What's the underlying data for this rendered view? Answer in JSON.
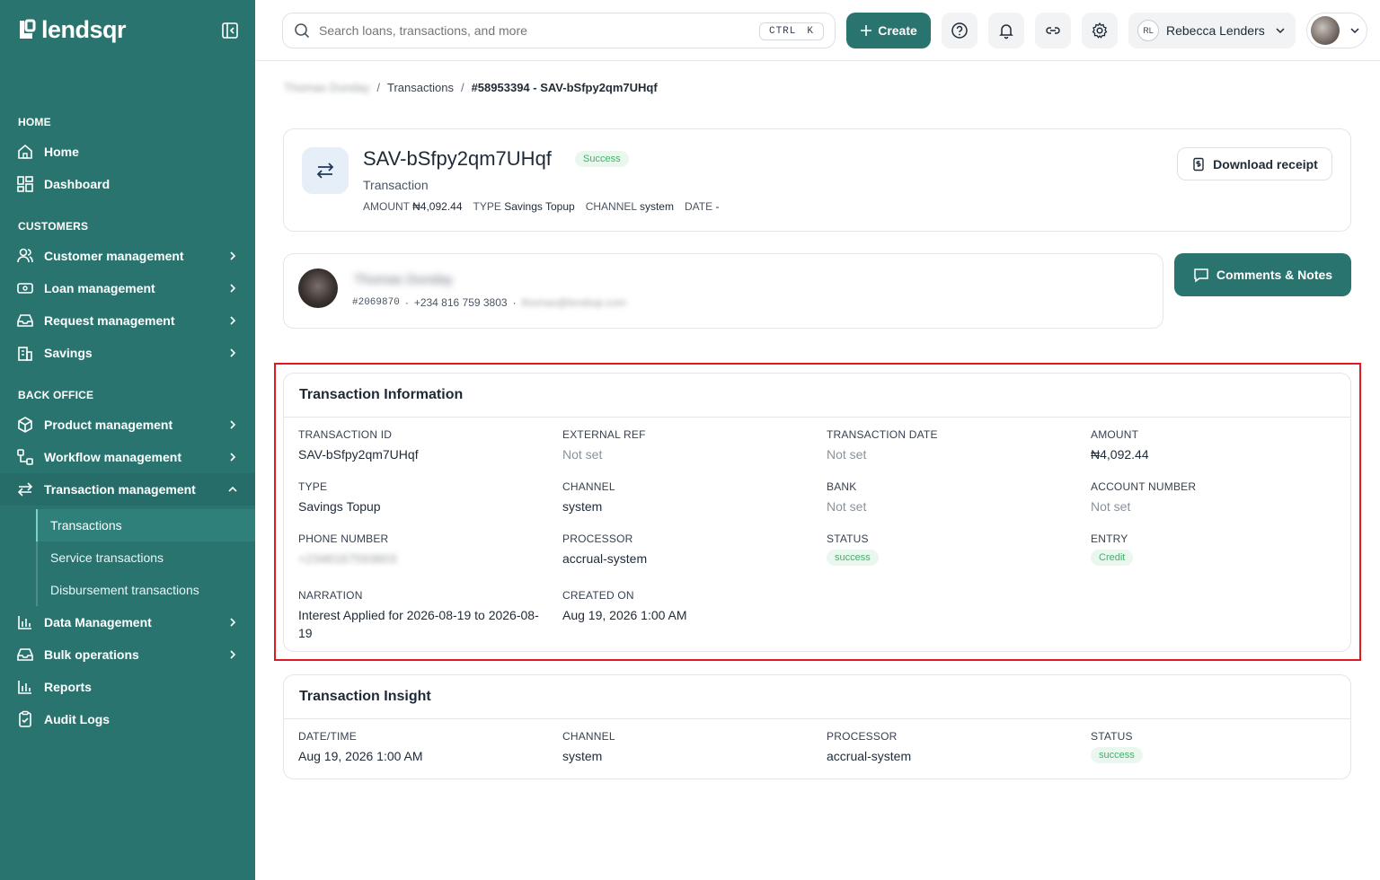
{
  "brand": {
    "name": "lendsqr"
  },
  "sidebar": {
    "sections": {
      "home": "HOME",
      "customers": "CUSTOMERS",
      "back_office": "BACK OFFICE"
    },
    "items": {
      "home": "Home",
      "dashboard": "Dashboard",
      "customer_management": "Customer management",
      "loan_management": "Loan management",
      "request_management": "Request management",
      "savings": "Savings",
      "product_management": "Product management",
      "workflow_management": "Workflow management",
      "transaction_management": "Transaction management",
      "transactions": "Transactions",
      "service_transactions": "Service transactions",
      "disbursement_transactions": "Disbursement transactions",
      "data_management": "Data Management",
      "bulk_operations": "Bulk operations",
      "reports": "Reports",
      "audit_logs": "Audit Logs"
    }
  },
  "topbar": {
    "search_placeholder": "Search loans, transactions, and more",
    "shortcut_ctrl": "CTRL",
    "shortcut_key": "K",
    "create_label": "Create",
    "user_initials": "RL",
    "user_name": "Rebecca Lenders"
  },
  "breadcrumb": {
    "customer": "Thomas Dunday",
    "section": "Transactions",
    "current": "#58953394 - SAV-bSfpy2qm7UHqf"
  },
  "transaction": {
    "ref": "SAV-bSfpy2qm7UHqf",
    "status_badge": "Success",
    "subtitle": "Transaction",
    "amount_label": "AMOUNT",
    "amount": "₦4,092.44",
    "type_label": "TYPE",
    "type": "Savings Topup",
    "channel_label": "CHANNEL",
    "channel": "system",
    "date_label": "DATE",
    "date": "-",
    "download_label": "Download receipt"
  },
  "customer": {
    "name": "Thomas Dunday",
    "id": "#2069870",
    "phone": "+234 816 759 3803",
    "email": "thomas@lendsqr.com"
  },
  "comments_label": "Comments & Notes",
  "info": {
    "title": "Transaction Information",
    "fields": {
      "transaction_id": {
        "label": "TRANSACTION ID",
        "value": "SAV-bSfpy2qm7UHqf"
      },
      "external_ref": {
        "label": "EXTERNAL REF",
        "value": "Not set"
      },
      "transaction_date": {
        "label": "TRANSACTION DATE",
        "value": "Not set"
      },
      "amount": {
        "label": "AMOUNT",
        "value": "₦4,092.44"
      },
      "type": {
        "label": "TYPE",
        "value": "Savings Topup"
      },
      "channel": {
        "label": "CHANNEL",
        "value": "system"
      },
      "bank": {
        "label": "BANK",
        "value": "Not set"
      },
      "account_number": {
        "label": "ACCOUNT NUMBER",
        "value": "Not set"
      },
      "phone_number": {
        "label": "PHONE NUMBER",
        "value": "+2348167593803"
      },
      "processor": {
        "label": "PROCESSOR",
        "value": "accrual-system"
      },
      "status": {
        "label": "STATUS",
        "value": "success"
      },
      "entry": {
        "label": "ENTRY",
        "value": "Credit"
      },
      "narration": {
        "label": "NARRATION",
        "value": "Interest Applied for 2026-08-19 to 2026-08-19"
      },
      "created_on": {
        "label": "CREATED ON",
        "value": "Aug 19, 2026 1:00 AM"
      }
    }
  },
  "insight": {
    "title": "Transaction Insight",
    "fields": {
      "datetime": {
        "label": "DATE/TIME",
        "value": "Aug 19, 2026 1:00 AM"
      },
      "channel": {
        "label": "CHANNEL",
        "value": "system"
      },
      "processor": {
        "label": "PROCESSOR",
        "value": "accrual-system"
      },
      "status": {
        "label": "STATUS",
        "value": "success"
      }
    }
  },
  "colors": {
    "sidebar": "#2a7470",
    "accent": "#2a7470",
    "success_bg": "#eaf7ee",
    "success_text": "#3fb16a",
    "highlight": "#e0181f"
  }
}
